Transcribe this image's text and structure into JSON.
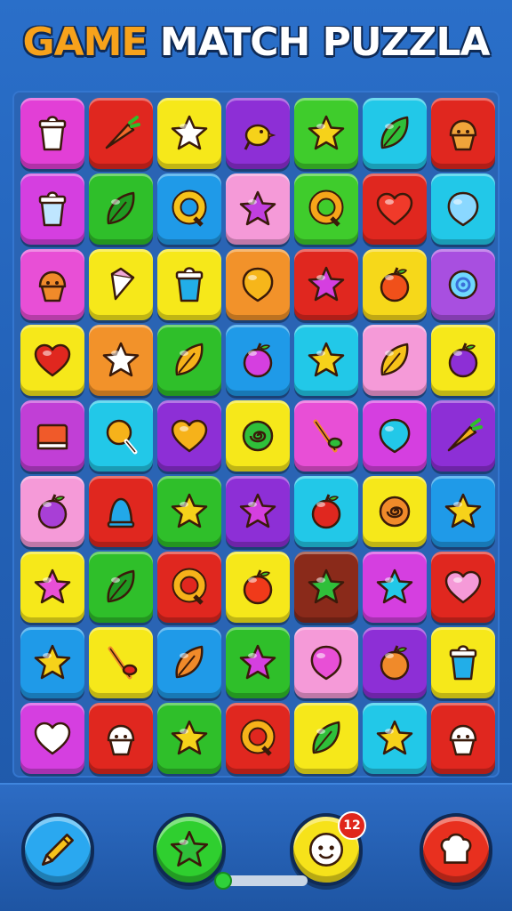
{
  "title": {
    "word1": "GAME",
    "word2": " MATCH PUZZLA"
  },
  "board": {
    "rows": [
      [
        {
          "bg": "#e23fd6",
          "icon": "cup",
          "color": "#ffffff"
        },
        {
          "bg": "#e0271f",
          "icon": "carrot",
          "color": "#f06a2a"
        },
        {
          "bg": "#f6e81a",
          "icon": "star",
          "color": "#ffffff"
        },
        {
          "bg": "#8d2fd6",
          "icon": "bird",
          "color": "#f6d21a"
        },
        {
          "bg": "#3fcc2c",
          "icon": "star",
          "color": "#f6d21a"
        },
        {
          "bg": "#22c8e8",
          "icon": "leaf",
          "color": "#2fbf3a"
        },
        {
          "bg": "#e0271f",
          "icon": "cupcake",
          "color": "#f0a43a"
        }
      ],
      [
        {
          "bg": "#d53fe0",
          "icon": "cup",
          "color": "#bfe6ff"
        },
        {
          "bg": "#2fbf2a",
          "icon": "leaf",
          "color": "#1f9a22"
        },
        {
          "bg": "#1f9ae8",
          "icon": "ring",
          "color": "#f6c21a"
        },
        {
          "bg": "#f59ad8",
          "icon": "star",
          "color": "#c13fe0"
        },
        {
          "bg": "#3fcc2c",
          "icon": "ring",
          "color": "#f6a51a"
        },
        {
          "bg": "#e0271f",
          "icon": "heart",
          "color": "#f03a2a"
        },
        {
          "bg": "#22c8e8",
          "icon": "balloon",
          "color": "#8ad8ff"
        }
      ],
      [
        {
          "bg": "#e84fd6",
          "icon": "cupcake",
          "color": "#f08a2a"
        },
        {
          "bg": "#f6e81a",
          "icon": "cone",
          "color": "#ffffff"
        },
        {
          "bg": "#f6e81a",
          "icon": "cup",
          "color": "#22aee8"
        },
        {
          "bg": "#f2922a",
          "icon": "balloon",
          "color": "#f6b61a"
        },
        {
          "bg": "#e0271f",
          "icon": "star",
          "color": "#d53fe0"
        },
        {
          "bg": "#f6d81a",
          "icon": "apple",
          "color": "#f0501a"
        },
        {
          "bg": "#a84fe0",
          "icon": "flower",
          "color": "#6fd8ff"
        }
      ],
      [
        {
          "bg": "#f6e81a",
          "icon": "heart",
          "color": "#e0271f"
        },
        {
          "bg": "#f2922a",
          "icon": "star",
          "color": "#ffffff"
        },
        {
          "bg": "#2fbf2a",
          "icon": "leaf",
          "color": "#f6b21a"
        },
        {
          "bg": "#1f9ae8",
          "icon": "apple",
          "color": "#d53fe0"
        },
        {
          "bg": "#22c8e8",
          "icon": "star",
          "color": "#f6d21a"
        },
        {
          "bg": "#f59ad8",
          "icon": "leaf",
          "color": "#f6c21a"
        },
        {
          "bg": "#f6e81a",
          "icon": "apple",
          "color": "#8d2fd6"
        }
      ],
      [
        {
          "bg": "#c13fd6",
          "icon": "book",
          "color": "#f05a2a"
        },
        {
          "bg": "#22c8e8",
          "icon": "lollipop",
          "color": "#f6b21a"
        },
        {
          "bg": "#8d2fd6",
          "icon": "heart",
          "color": "#f6b21a"
        },
        {
          "bg": "#f6e81a",
          "icon": "swirl",
          "color": "#2fbf3a"
        },
        {
          "bg": "#e84fd6",
          "icon": "branch",
          "color": "#2fbf3a"
        },
        {
          "bg": "#d53fe0",
          "icon": "balloon",
          "color": "#22c8e8"
        },
        {
          "bg": "#8d2fd6",
          "icon": "carrot",
          "color": "#f6b21a"
        }
      ],
      [
        {
          "bg": "#f59ad8",
          "icon": "apple",
          "color": "#a83fd6"
        },
        {
          "bg": "#e0271f",
          "icon": "bell",
          "color": "#22a8e8"
        },
        {
          "bg": "#2fbf2a",
          "icon": "star",
          "color": "#f6d21a"
        },
        {
          "bg": "#8d2fd6",
          "icon": "star",
          "color": "#d53fe0"
        },
        {
          "bg": "#22c8e8",
          "icon": "apple",
          "color": "#e0271f"
        },
        {
          "bg": "#f6e81a",
          "icon": "swirl",
          "color": "#f08a2a"
        },
        {
          "bg": "#1f9ae8",
          "icon": "star",
          "color": "#f6d21a"
        }
      ],
      [
        {
          "bg": "#f6e81a",
          "icon": "star",
          "color": "#e84fd6"
        },
        {
          "bg": "#2fbf2a",
          "icon": "leaf",
          "color": "#1f9a22"
        },
        {
          "bg": "#e0271f",
          "icon": "ring",
          "color": "#f6b21a"
        },
        {
          "bg": "#f6e81a",
          "icon": "apple",
          "color": "#f03a1a"
        },
        {
          "bg": "#8a2a1a",
          "icon": "star",
          "color": "#2fbf3a"
        },
        {
          "bg": "#d53fe0",
          "icon": "star",
          "color": "#22c8e8"
        },
        {
          "bg": "#e0271f",
          "icon": "heart",
          "color": "#f59ad8"
        }
      ],
      [
        {
          "bg": "#1f9ae8",
          "icon": "star",
          "color": "#f6d21a"
        },
        {
          "bg": "#f6e81a",
          "icon": "branch",
          "color": "#e0271f"
        },
        {
          "bg": "#1f9ae8",
          "icon": "leaf",
          "color": "#f08a2a"
        },
        {
          "bg": "#2fbf2a",
          "icon": "star",
          "color": "#d53fe0"
        },
        {
          "bg": "#f59ad8",
          "icon": "balloon",
          "color": "#e84fd6"
        },
        {
          "bg": "#8d2fd6",
          "icon": "apple",
          "color": "#f08a2a"
        },
        {
          "bg": "#f6e81a",
          "icon": "cup",
          "color": "#22aee8"
        }
      ],
      [
        {
          "bg": "#d53fe0",
          "icon": "heart",
          "color": "#ffffff"
        },
        {
          "bg": "#e0271f",
          "icon": "cupcake",
          "color": "#ffffff"
        },
        {
          "bg": "#2fbf2a",
          "icon": "star",
          "color": "#f6d21a"
        },
        {
          "bg": "#e0271f",
          "icon": "ring",
          "color": "#f6b21a"
        },
        {
          "bg": "#f6e81a",
          "icon": "leaf",
          "color": "#2fbf3a"
        },
        {
          "bg": "#22c8e8",
          "icon": "star",
          "color": "#f6d21a"
        },
        {
          "bg": "#e0271f",
          "icon": "cupcake",
          "color": "#ffffff"
        }
      ]
    ]
  },
  "controls": {
    "pencil": {
      "bg": "#2aa8f0",
      "icon": "pencil"
    },
    "star": {
      "bg": "#2fcf2f",
      "icon": "star"
    },
    "face": {
      "bg": "#f6e21a",
      "icon": "face",
      "badge": "12"
    },
    "chef": {
      "bg": "#e8301f",
      "icon": "chef-hat"
    }
  },
  "progress": {
    "value": 0.05
  }
}
